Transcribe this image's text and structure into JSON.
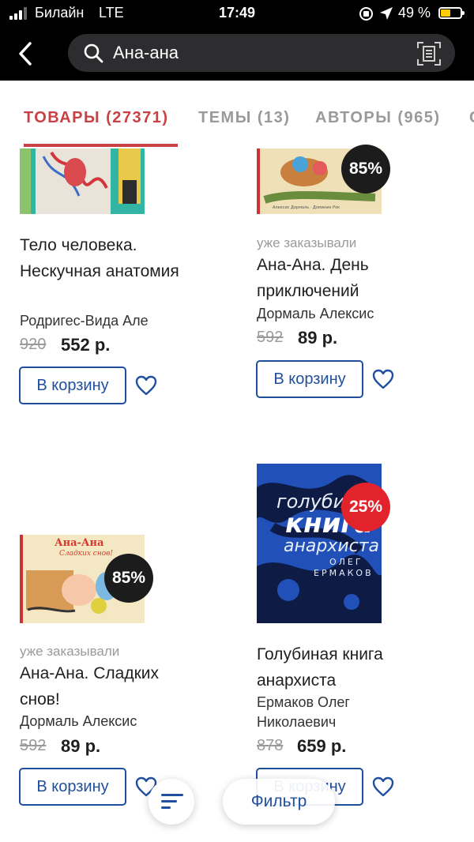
{
  "status_bar": {
    "carrier": "Билайн",
    "network": "LTE",
    "time": "17:49",
    "battery": "49 %"
  },
  "search": {
    "query": "Ана-ана",
    "icons": [
      "back-chevron-icon",
      "search-icon",
      "barcode-scan-icon"
    ]
  },
  "tabs": [
    {
      "label": "ТОВАРЫ (27371)",
      "active": true
    },
    {
      "label": "ТЕМЫ (13)",
      "active": false
    },
    {
      "label": "АВТОРЫ (965)",
      "active": false
    }
  ],
  "colors": {
    "accent": "#c94045",
    "button_blue": "#1f4f9e",
    "badge_dark": "#1c1c1c",
    "badge_red": "#e3232b"
  },
  "products": [
    {
      "ordered_note": "",
      "title": "Тело человека. Нескучная анатомия",
      "author": "Родригес-Вида Але",
      "badge": "",
      "price_old": "920",
      "price_new": "552 р.",
      "cart_label": "В корзину"
    },
    {
      "ordered_note": "уже заказывали",
      "title": "Ана-Ана. День приключений",
      "author": "Дормаль Алексис",
      "badge": "85%",
      "price_old": "592",
      "price_new": "89 р.",
      "cart_label": "В корзину"
    },
    {
      "ordered_note": "уже заказывали",
      "title": "Ана-Ана. Сладких снов!",
      "author": "Дормаль Алексис",
      "badge": "85%",
      "cover_text_1": "Ана-Ана",
      "cover_text_2": "Сладких снов!",
      "price_old": "592",
      "price_new": "89 р.",
      "cart_label": "В корзину"
    },
    {
      "ordered_note": "",
      "title": "Голубиная книга анархиста",
      "author": "Ермаков Олег Николаевич",
      "badge": "25%",
      "cover_text_1": "голубиная",
      "cover_text_2": "книга",
      "cover_text_3": "анархиста",
      "cover_text_4": "ОЛЕГ",
      "cover_text_5": "ЕРМАКОВ",
      "price_old": "878",
      "price_new": "659 р.",
      "cart_label": "В корзину"
    }
  ],
  "bottom": {
    "filter_label": "Фильтр"
  }
}
